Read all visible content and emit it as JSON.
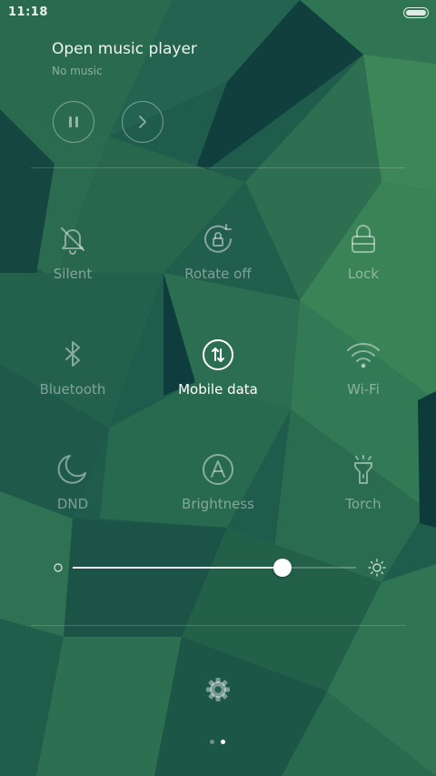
{
  "status_bar": {
    "time": "11:18",
    "battery_icon": "battery-icon"
  },
  "music": {
    "title": "Open music player",
    "subtitle": "No music",
    "pause_icon": "pause-icon",
    "next_icon": "chevron-right-icon"
  },
  "toggles": [
    {
      "label": "Silent",
      "icon": "bell-off-icon",
      "active": false
    },
    {
      "label": "Rotate off",
      "icon": "rotation-lock-icon",
      "active": false
    },
    {
      "label": "Lock",
      "icon": "lock-icon",
      "active": false
    },
    {
      "label": "Bluetooth",
      "icon": "bluetooth-icon",
      "active": false
    },
    {
      "label": "Mobile data",
      "icon": "mobile-data-icon",
      "active": true
    },
    {
      "label": "Wi-Fi",
      "icon": "wifi-icon",
      "active": false
    },
    {
      "label": "DND",
      "icon": "moon-icon",
      "active": false
    },
    {
      "label": "Brightness",
      "icon": "auto-brightness-icon",
      "active": false
    },
    {
      "label": "Torch",
      "icon": "flashlight-icon",
      "active": false
    }
  ],
  "brightness": {
    "level_percent": 74,
    "low_icon": "brightness-low-icon",
    "high_icon": "brightness-high-icon"
  },
  "settings_icon": "gear-icon",
  "pagination": {
    "page_count": 2,
    "current_page": 2
  },
  "colors": {
    "active": "#ffffff",
    "inactive": "rgba(255,255,255,0.42)",
    "background": "#1f5a4a"
  }
}
